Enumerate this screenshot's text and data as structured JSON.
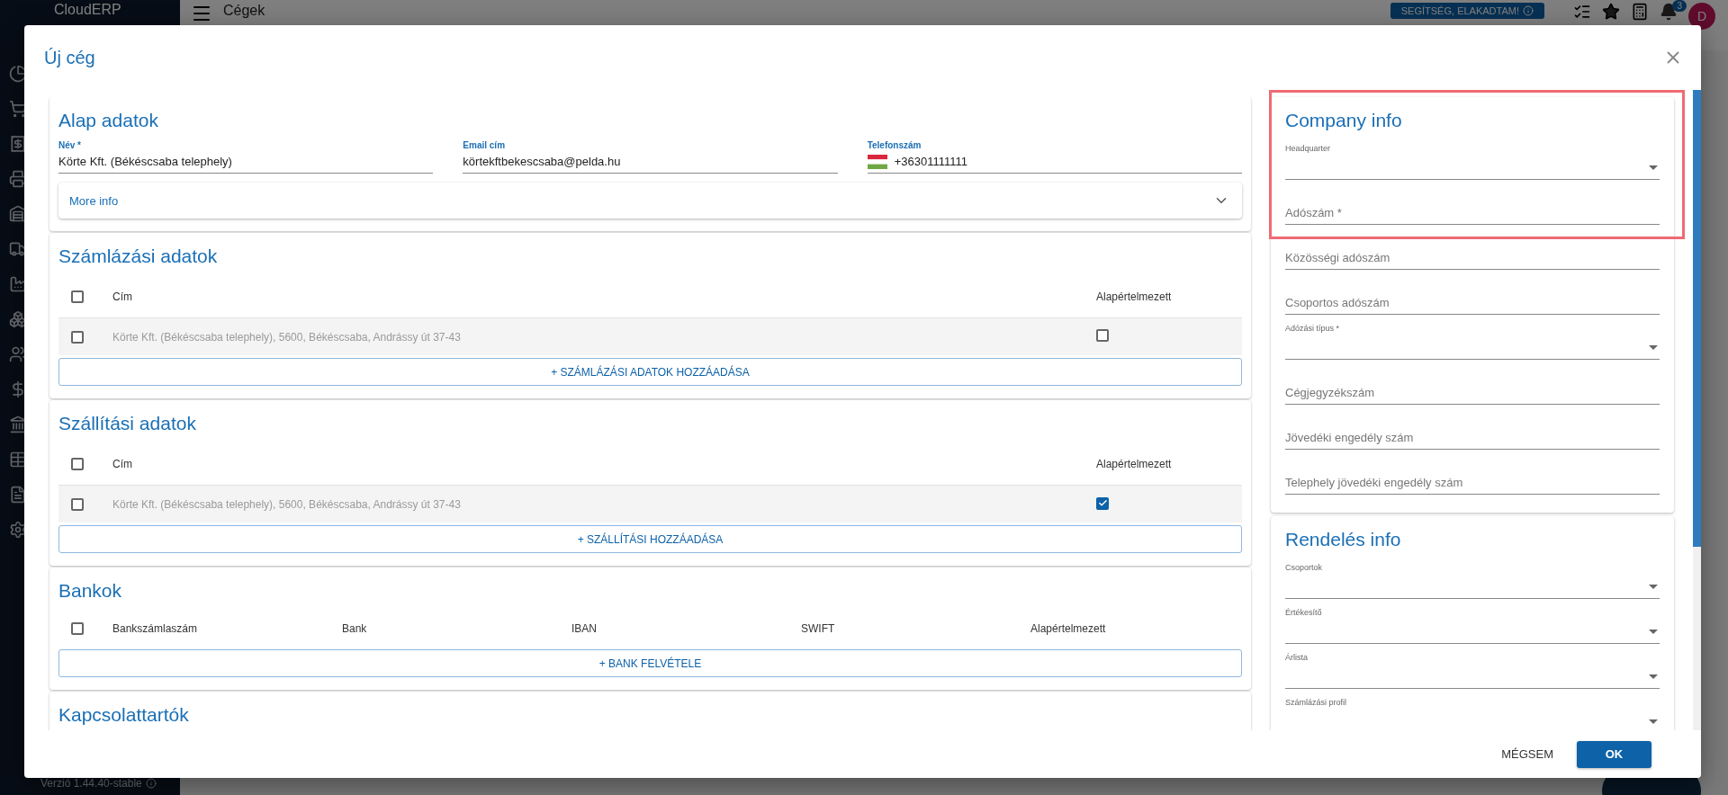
{
  "app": {
    "logo": "CloudERP",
    "page_title": "Cégek",
    "help_button": "SEGÍTSÉG, ELAKADTAM!",
    "notification_count": "3",
    "avatar_initial": "D",
    "version": "Verzió 1.44.40-stable"
  },
  "dialog": {
    "title": "Új cég",
    "basic": {
      "title": "Alap adatok",
      "fields": [
        {
          "kind": "text",
          "label": "Név *",
          "value": "Körte Kft. (Békéscsaba telephely)"
        },
        {
          "kind": "text",
          "label": "Email cím",
          "value": "körtekftbekescsaba@pelda.hu"
        },
        {
          "kind": "phone",
          "label": "Telefonszám",
          "value": "+36301111111"
        }
      ],
      "more_info": {
        "label": "More info",
        "expanded": false
      }
    },
    "address_sections": [
      {
        "title": "Számlázási adatok",
        "columns": [
          "Cím",
          "Alapértelmezett"
        ],
        "all_checked": false,
        "rows": [
          {
            "address": "Körte Kft. (Békéscsaba telephely), 5600, Békéscsaba, Andrássy út 37-43",
            "selected": false,
            "default": false
          }
        ],
        "add_button": "+ SZÁMLÁZÁSI ADATOK HOZZÁADÁSA"
      },
      {
        "title": "Szállítási adatok",
        "columns": [
          "Cím",
          "Alapértelmezett"
        ],
        "all_checked": false,
        "rows": [
          {
            "address": "Körte Kft. (Békéscsaba telephely), 5600, Békéscsaba, Andrássy út 37-43",
            "selected": false,
            "default": true
          }
        ],
        "add_button": "+ SZÁLLÍTÁSI HOZZÁADÁSA"
      }
    ],
    "banks": {
      "title": "Bankok",
      "columns": [
        "Bankszámlaszám",
        "Bank",
        "IBAN",
        "SWIFT",
        "Alapértelmezett"
      ],
      "all_checked": false,
      "add_button": "+ BANK FELVÉTELE"
    },
    "contacts": {
      "title": "Kapcsolattartók"
    },
    "company_info": {
      "title": "Company info",
      "highlighted": true,
      "fields": [
        {
          "kind": "select",
          "label": "Headquarter",
          "highlighted": true
        },
        {
          "kind": "text",
          "label": "Adószám *",
          "highlighted": true
        },
        {
          "kind": "text",
          "label": "Közösségi adószám",
          "highlighted": false
        },
        {
          "kind": "text",
          "label": "Csoportos adószám",
          "highlighted": false
        },
        {
          "kind": "select",
          "label": "Adózási típus *",
          "highlighted": false
        },
        {
          "kind": "text",
          "label": "Cégjegyzékszám",
          "highlighted": false
        },
        {
          "kind": "text",
          "label": "Jövedéki engedély szám",
          "highlighted": false
        },
        {
          "kind": "text",
          "label": "Telephely jövedéki engedély szám",
          "highlighted": false
        }
      ]
    },
    "order_info": {
      "title": "Rendelés info",
      "fields": [
        {
          "kind": "select",
          "label": "Csoportok"
        },
        {
          "kind": "select",
          "label": "Értékesítő"
        },
        {
          "kind": "select",
          "label": "Árlista"
        },
        {
          "kind": "select",
          "label": "Számlázási profil"
        }
      ]
    },
    "cancel_button": "MÉGSEM",
    "ok_button": "OK"
  }
}
